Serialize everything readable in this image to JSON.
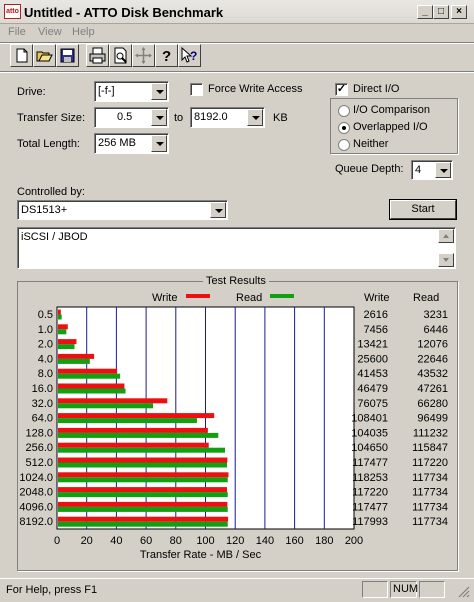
{
  "window": {
    "title": "Untitled - ATTO Disk Benchmark",
    "app_icon_text": "atto"
  },
  "menu": {
    "items": [
      "File",
      "View",
      "Help"
    ]
  },
  "toolbar": {
    "icons": [
      "new-icon",
      "open-icon",
      "save-icon",
      "print-icon",
      "print-preview-icon",
      "move-icon",
      "help-icon",
      "context-help-icon"
    ]
  },
  "form": {
    "drive_label": "Drive:",
    "drive_value": "[-f-]",
    "force_write_label": "Force Write Access",
    "force_write_checked": false,
    "direct_io_label": "Direct I/O",
    "direct_io_checked": true,
    "transfer_size_label": "Transfer Size:",
    "transfer_from": "0.5",
    "to_label": "to",
    "transfer_to": "8192.0",
    "kb_label": "KB",
    "total_length_label": "Total Length:",
    "total_length_value": "256 MB",
    "radio_io_comparison": "I/O Comparison",
    "radio_overlapped": "Overlapped I/O",
    "radio_neither": "Neither",
    "radio_selected": "Overlapped I/O",
    "queue_depth_label": "Queue Depth:",
    "queue_depth_value": "4",
    "controlled_by_label": "Controlled by:",
    "controlled_by_value": "DS1513+",
    "start_label": "Start",
    "notes_text": "iSCSI / JBOD"
  },
  "results": {
    "group_title": "Test Results",
    "write_legend": "Write",
    "read_legend": "Read",
    "write_header": "Write",
    "read_header": "Read",
    "write_color": "#ee1010",
    "read_color": "#10a010"
  },
  "chart_data": {
    "type": "bar",
    "orientation": "horizontal",
    "categories": [
      "0.5",
      "1.0",
      "2.0",
      "4.0",
      "8.0",
      "16.0",
      "32.0",
      "64.0",
      "128.0",
      "256.0",
      "512.0",
      "1024.0",
      "2048.0",
      "4096.0",
      "8192.0"
    ],
    "series": [
      {
        "name": "Write",
        "values": [
          2616,
          7456,
          13421,
          25600,
          41453,
          46479,
          76075,
          108401,
          104035,
          104650,
          117477,
          118253,
          117220,
          117477,
          117993
        ]
      },
      {
        "name": "Read",
        "values": [
          3231,
          6446,
          12076,
          22646,
          43532,
          47261,
          66280,
          96499,
          111232,
          115847,
          117220,
          117734,
          117734,
          117734,
          117734
        ]
      }
    ],
    "xlabel": "Transfer Rate - MB / Sec",
    "xlim": [
      0,
      200
    ],
    "xticks": [
      "0",
      "20",
      "40",
      "60",
      "80",
      "100",
      "120",
      "140",
      "160",
      "180",
      "200"
    ],
    "grid": true
  },
  "status": {
    "help_text": "For Help, press F1",
    "num_label": "NUM"
  }
}
